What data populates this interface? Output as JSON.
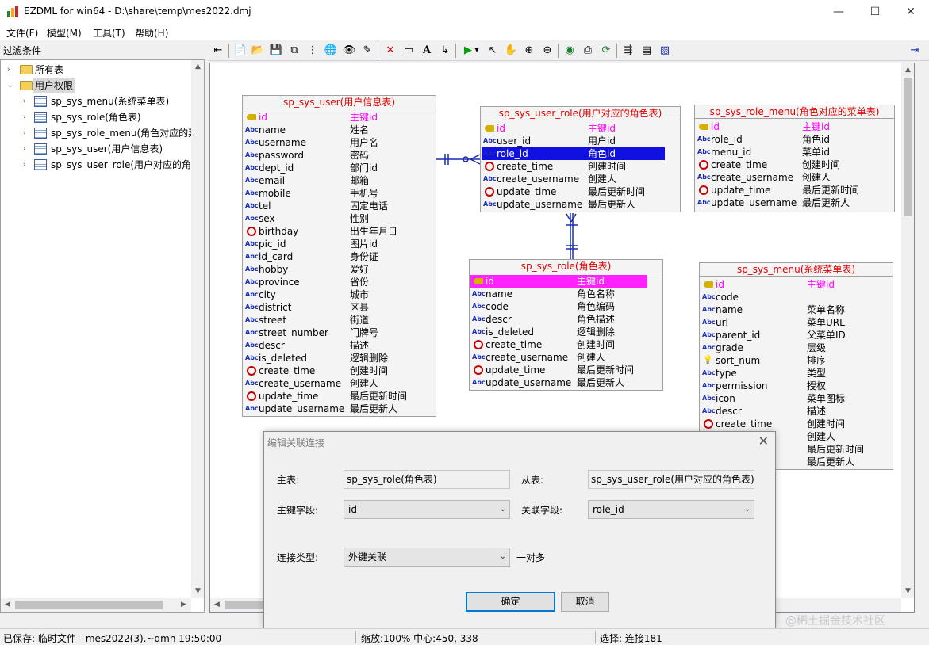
{
  "window": {
    "title": "EZDML for win64 - D:\\share\\temp\\mes2022.dmj",
    "min_glyph": "—",
    "max_glyph": "☐",
    "close_glyph": "✕"
  },
  "menu": [
    "文件(F)",
    "模型(M)",
    "工具(T)",
    "帮助(H)"
  ],
  "left_panel": {
    "filter_label": "过滤条件",
    "tree": {
      "all_tables": "所有表",
      "group": "用户权限",
      "items": [
        "sp_sys_menu(系统菜单表)",
        "sp_sys_role(角色表)",
        "sp_sys_role_menu(角色对应的菜",
        "sp_sys_user(用户信息表)",
        "sp_sys_user_role(用户对应的角色"
      ]
    }
  },
  "toolbar": {
    "icons": [
      "sidebar-toggle-icon",
      "new-file-icon",
      "open-folder-icon",
      "save-icon",
      "copy-icon",
      "tree-structure-icon",
      "globe-icon",
      "find-icon",
      "highlight-icon",
      "delete-icon",
      "rectangle-icon",
      "text-icon",
      "connector-icon",
      "run-icon",
      "dropdown-icon",
      "pointer-icon",
      "hand-icon",
      "zoom-in-icon",
      "zoom-out-icon",
      "eye-icon",
      "print-icon",
      "refresh-icon",
      "export-icon",
      "properties-icon",
      "image-icon",
      "panel-toggle-icon"
    ],
    "glyphs": [
      "⇤",
      "📄",
      "📂",
      "💾",
      "⧉",
      "⋮",
      "🌐",
      "👁",
      "✎",
      "✕",
      "▭",
      "A",
      "↳",
      "▶",
      "▾",
      "↖",
      "✋",
      "⊕",
      "⊖",
      "◉",
      "⎙",
      "⟳",
      "⇶",
      "▤",
      "▧",
      "⇥"
    ],
    "colors": {
      "delete": "#cc0000",
      "run": "#00a000",
      "accent": "#1a2bb0"
    }
  },
  "entities": {
    "user": {
      "title": "sp_sys_user(用户信息表)",
      "fields": [
        {
          "icon": "key",
          "name": "id",
          "cn": "主键id"
        },
        {
          "icon": "abc",
          "name": "name",
          "cn": "姓名"
        },
        {
          "icon": "abc",
          "name": "username",
          "cn": "用户名"
        },
        {
          "icon": "abc",
          "name": "password",
          "cn": "密码"
        },
        {
          "icon": "abc",
          "name": "dept_id",
          "cn": "部门id"
        },
        {
          "icon": "abc",
          "name": "email",
          "cn": "邮箱"
        },
        {
          "icon": "abc",
          "name": "mobile",
          "cn": "手机号"
        },
        {
          "icon": "abc",
          "name": "tel",
          "cn": "固定电话"
        },
        {
          "icon": "abc",
          "name": "sex",
          "cn": "性别"
        },
        {
          "icon": "clock",
          "name": "birthday",
          "cn": "出生年月日"
        },
        {
          "icon": "abc",
          "name": "pic_id",
          "cn": "图片id"
        },
        {
          "icon": "abc",
          "name": "id_card",
          "cn": "身份证"
        },
        {
          "icon": "abc",
          "name": "hobby",
          "cn": "爱好"
        },
        {
          "icon": "abc",
          "name": "province",
          "cn": "省份"
        },
        {
          "icon": "abc",
          "name": "city",
          "cn": "城市"
        },
        {
          "icon": "abc",
          "name": "district",
          "cn": "区县"
        },
        {
          "icon": "abc",
          "name": "street",
          "cn": "街道"
        },
        {
          "icon": "abc",
          "name": "street_number",
          "cn": "门牌号"
        },
        {
          "icon": "abc",
          "name": "descr",
          "cn": "描述"
        },
        {
          "icon": "abc",
          "name": "is_deleted",
          "cn": "逻辑删除"
        },
        {
          "icon": "clock",
          "name": "create_time",
          "cn": "创建时间"
        },
        {
          "icon": "abc",
          "name": "create_username",
          "cn": "创建人"
        },
        {
          "icon": "clock",
          "name": "update_time",
          "cn": "最后更新时间"
        },
        {
          "icon": "abc",
          "name": "update_username",
          "cn": "最后更新人"
        }
      ]
    },
    "user_role": {
      "title": "sp_sys_user_role(用户对应的角色表)",
      "fields": [
        {
          "icon": "key",
          "name": "id",
          "cn": "主键id"
        },
        {
          "icon": "abc",
          "name": "user_id",
          "cn": "用户id"
        },
        {
          "icon": "abc",
          "name": "role_id",
          "cn": "角色id",
          "selected": true
        },
        {
          "icon": "clock",
          "name": "create_time",
          "cn": "创建时间"
        },
        {
          "icon": "abc",
          "name": "create_username",
          "cn": "创建人"
        },
        {
          "icon": "clock",
          "name": "update_time",
          "cn": "最后更新时间"
        },
        {
          "icon": "abc",
          "name": "update_username",
          "cn": "最后更新人"
        }
      ]
    },
    "role_menu": {
      "title": "sp_sys_role_menu(角色对应的菜单表)",
      "fields": [
        {
          "icon": "key",
          "name": "id",
          "cn": "主键id"
        },
        {
          "icon": "abc",
          "name": "role_id",
          "cn": "角色id"
        },
        {
          "icon": "abc",
          "name": "menu_id",
          "cn": "菜单id"
        },
        {
          "icon": "clock",
          "name": "create_time",
          "cn": "创建时间"
        },
        {
          "icon": "abc",
          "name": "create_username",
          "cn": "创建人"
        },
        {
          "icon": "clock",
          "name": "update_time",
          "cn": "最后更新时间"
        },
        {
          "icon": "abc",
          "name": "update_username",
          "cn": "最后更新人"
        }
      ]
    },
    "role": {
      "title": "sp_sys_role(角色表)",
      "fields": [
        {
          "icon": "key",
          "name": "id",
          "cn": "主键id",
          "selected": true
        },
        {
          "icon": "abc",
          "name": "name",
          "cn": "角色名称"
        },
        {
          "icon": "abc",
          "name": "code",
          "cn": "角色编码"
        },
        {
          "icon": "abc",
          "name": "descr",
          "cn": "角色描述"
        },
        {
          "icon": "abc",
          "name": "is_deleted",
          "cn": "逻辑删除"
        },
        {
          "icon": "clock",
          "name": "create_time",
          "cn": "创建时间"
        },
        {
          "icon": "abc",
          "name": "create_username",
          "cn": "创建人"
        },
        {
          "icon": "clock",
          "name": "update_time",
          "cn": "最后更新时间"
        },
        {
          "icon": "abc",
          "name": "update_username",
          "cn": "最后更新人"
        }
      ]
    },
    "menu": {
      "title": "sp_sys_menu(系统菜单表)",
      "fields": [
        {
          "icon": "key",
          "name": "id",
          "cn": "主键id"
        },
        {
          "icon": "abc",
          "name": "code",
          "cn": ""
        },
        {
          "icon": "abc",
          "name": "name",
          "cn": "菜单名称"
        },
        {
          "icon": "abc",
          "name": "url",
          "cn": "菜单URL"
        },
        {
          "icon": "abc",
          "name": "parent_id",
          "cn": "父菜单ID"
        },
        {
          "icon": "abc",
          "name": "grade",
          "cn": "层级"
        },
        {
          "icon": "bulb",
          "name": "sort_num",
          "cn": "排序"
        },
        {
          "icon": "abc",
          "name": "type",
          "cn": "类型"
        },
        {
          "icon": "abc",
          "name": "permission",
          "cn": "授权"
        },
        {
          "icon": "abc",
          "name": "icon",
          "cn": "菜单图标"
        },
        {
          "icon": "abc",
          "name": "descr",
          "cn": "描述"
        },
        {
          "icon": "clock",
          "name": "create_time",
          "cn": "创建时间"
        },
        {
          "icon": "abc",
          "name": "me",
          "cn": "创建人"
        },
        {
          "icon": "abc",
          "name": "",
          "cn": "最后更新时间"
        },
        {
          "icon": "abc",
          "name": "ame",
          "cn": "最后更新人"
        }
      ]
    }
  },
  "dialog": {
    "title": "编辑关联连接",
    "master_label": "主表:",
    "master_value": "sp_sys_role(角色表)",
    "detail_label": "从表:",
    "detail_value": "sp_sys_user_role(用户对应的角色表)",
    "pk_label": "主键字段:",
    "pk_value": "id",
    "fk_label": "关联字段:",
    "fk_value": "role_id",
    "link_type_label": "连接类型:",
    "link_type_value": "外键关联",
    "cardinality": "一对多",
    "ok": "确定",
    "cancel": "取消"
  },
  "statusbar": {
    "saved": "已保存: 临时文件 - mes2022(3).~dmh 19:50:00",
    "zoom": "缩放:100% 中心:450, 338",
    "selection": "选择: 连接181"
  },
  "watermark": "@稀土掘金技术社区"
}
